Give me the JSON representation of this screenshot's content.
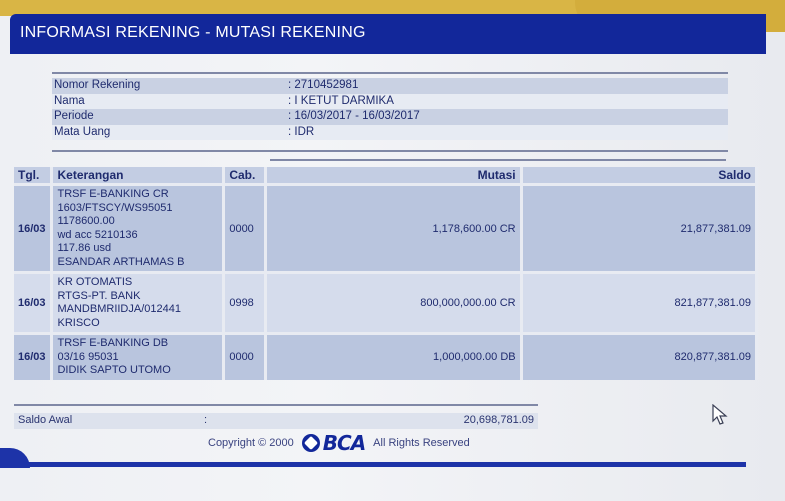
{
  "header": {
    "title": "INFORMASI REKENING - MUTASI REKENING"
  },
  "account_info": [
    {
      "label": "Nomor Rekening",
      "value": ": 2710452981"
    },
    {
      "label": "Nama",
      "value": ": I KETUT DARMIKA"
    },
    {
      "label": "Periode",
      "value": ": 16/03/2017 - 16/03/2017"
    },
    {
      "label": "Mata Uang",
      "value": ": IDR"
    }
  ],
  "table": {
    "headers": {
      "tgl": "Tgl.",
      "keterangan": "Keterangan",
      "cab": "Cab.",
      "mutasi": "Mutasi",
      "saldo": "Saldo"
    },
    "rows": [
      {
        "tgl": "16/03",
        "keterangan": [
          "TRSF E-BANKING CR",
          "1603/FTSCY/WS95051",
          "1178600.00",
          "wd acc 5210136",
          "117.86 usd",
          "ESANDAR ARTHAMAS B"
        ],
        "cab": "0000",
        "mutasi": "1,178,600.00 CR",
        "saldo": "21,877,381.09"
      },
      {
        "tgl": "16/03",
        "keterangan": [
          "KR OTOMATIS",
          "RTGS-PT. BANK",
          "MANDBMRIIDJA/012441",
          "KRISCO"
        ],
        "cab": "0998",
        "mutasi": "800,000,000.00 CR",
        "saldo": "821,877,381.09"
      },
      {
        "tgl": "16/03",
        "keterangan": [
          "TRSF E-BANKING DB",
          "03/16 95031",
          "DIDIK SAPTO UTOMO"
        ],
        "cab": "0000",
        "mutasi": "1,000,000.00 DB",
        "saldo": "820,877,381.09"
      }
    ]
  },
  "saldo_awal": {
    "label": "Saldo Awal",
    "colon": ":",
    "value": "20,698,781.09"
  },
  "footer": {
    "copyright": "Copyright © 2000",
    "logo_text": "BCA",
    "rights": "All Rights Reserved"
  },
  "colors": {
    "header_blue": "#12279a",
    "gold": "#d9b545",
    "row_dark": "#b9c5de",
    "row_light": "#d5dcec"
  }
}
